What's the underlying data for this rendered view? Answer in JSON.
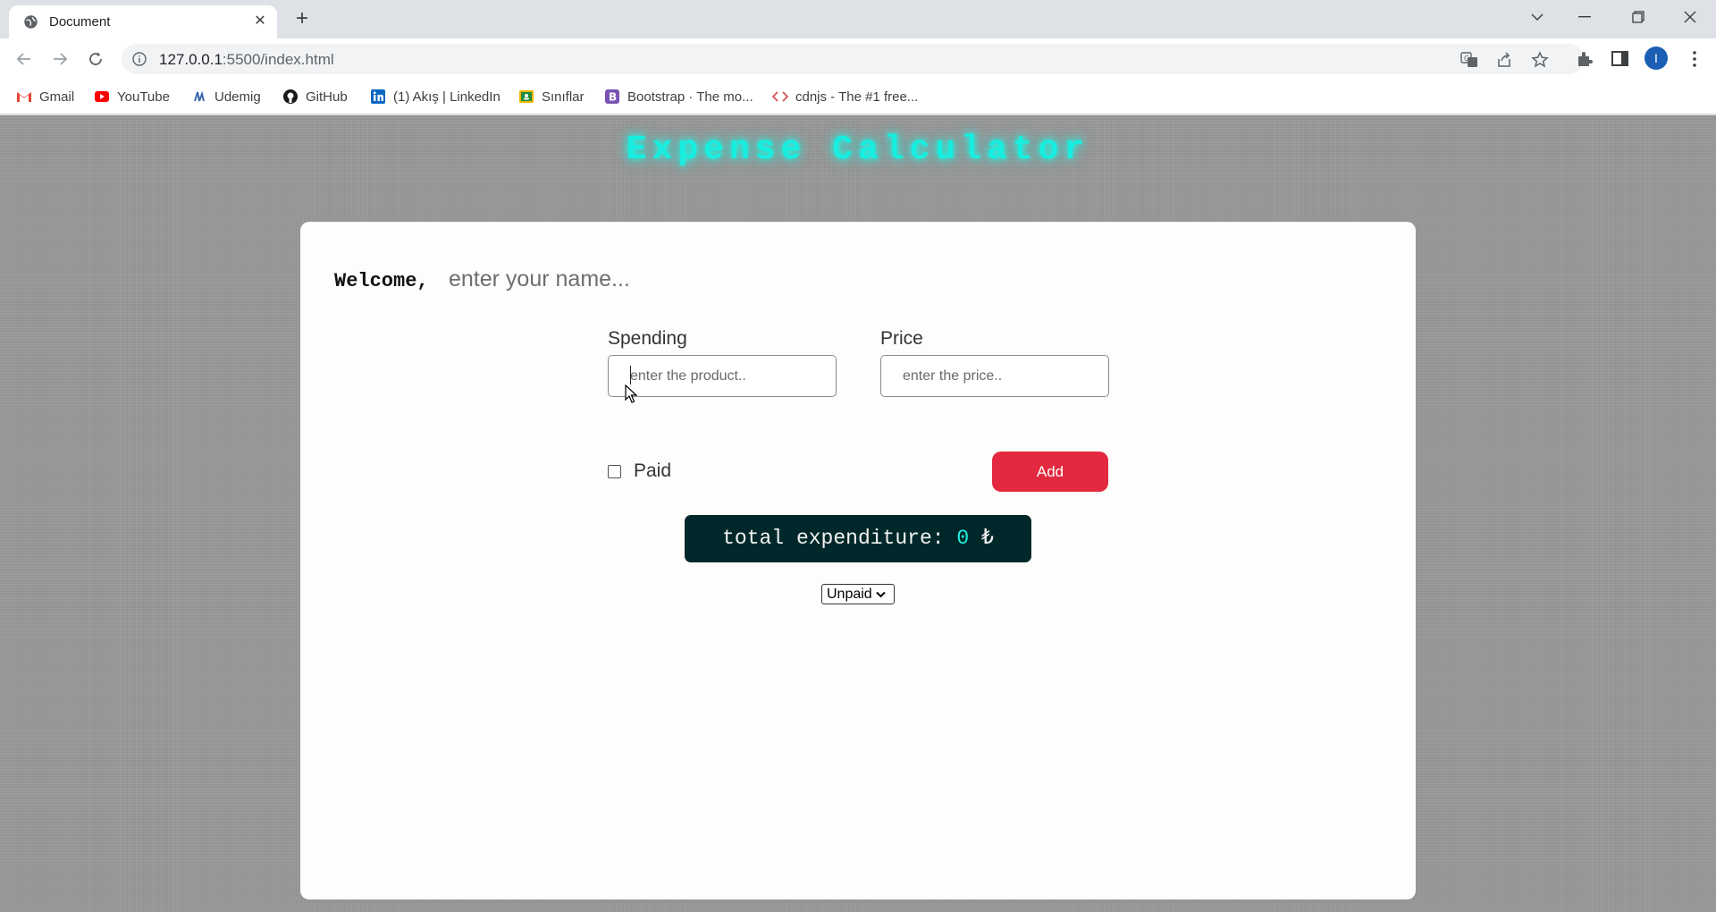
{
  "browser": {
    "tab_title": "Document",
    "url_host": "127.0.0.1",
    "url_rest": ":5500/index.html",
    "avatar_letter": "I",
    "bookmarks": [
      {
        "label": "Gmail",
        "icon": "gmail-icon",
        "color": "#ea4335"
      },
      {
        "label": "YouTube",
        "icon": "youtube-icon",
        "color": "#ff0000"
      },
      {
        "label": "Udemig",
        "icon": "udemig-icon",
        "color": "#3c6ab0"
      },
      {
        "label": "GitHub",
        "icon": "github-icon",
        "color": "#181717"
      },
      {
        "label": "(1) Akış | LinkedIn",
        "icon": "linkedin-icon",
        "color": "#0a66c2"
      },
      {
        "label": "Sınıflar",
        "icon": "classroom-icon",
        "color": "#f4b400"
      },
      {
        "label": "Bootstrap · The mo...",
        "icon": "bootstrap-icon",
        "color": "#7952b3"
      },
      {
        "label": "cdnjs - The #1 free...",
        "icon": "code-icon",
        "color": "#d9534f"
      }
    ]
  },
  "app": {
    "title": "Expense Calculator",
    "welcome_label": "Welcome,",
    "name_placeholder": "enter your name...",
    "spending_label": "Spending",
    "price_label": "Price",
    "product_placeholder": "enter the product..",
    "price_placeholder": "enter the price..",
    "paid_label": "Paid",
    "paid_checked": false,
    "add_label": "Add",
    "total_label": "total expenditure:",
    "total_value": "0",
    "currency": "₺",
    "filter_selected": "Unpaid",
    "accent_color": "#17eee0",
    "button_color": "#e3293f"
  }
}
